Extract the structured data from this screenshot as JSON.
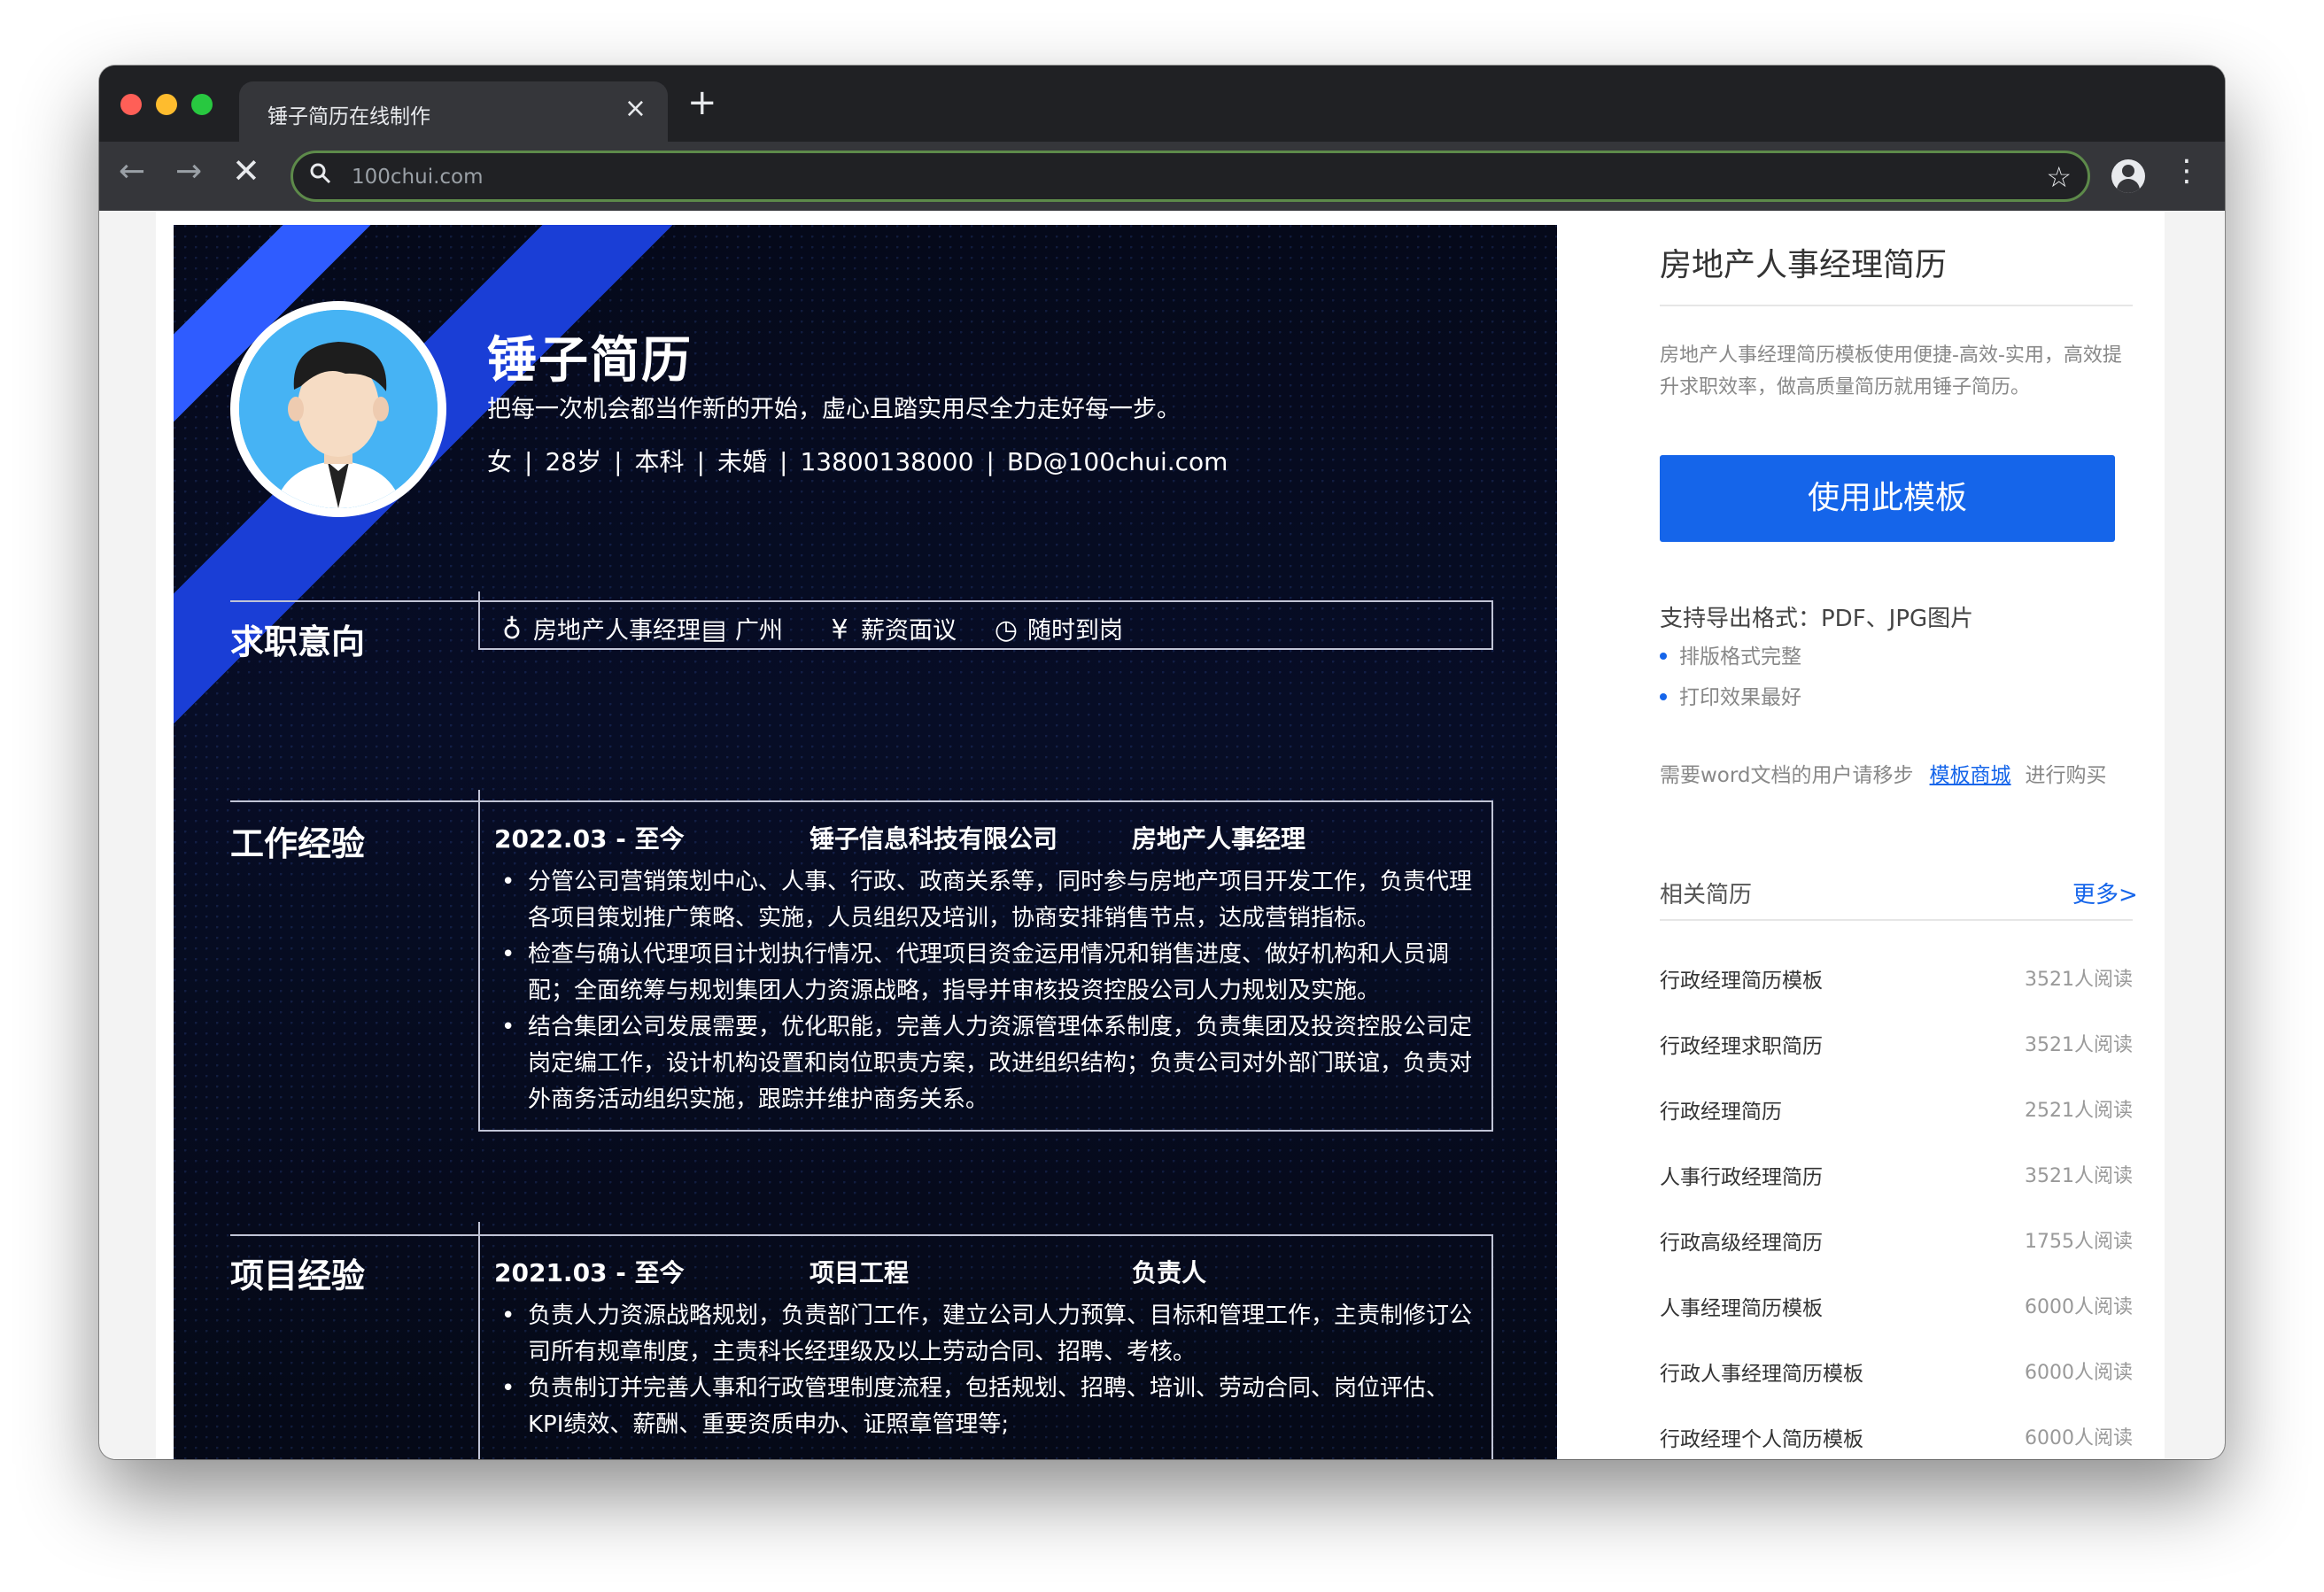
{
  "browser": {
    "tab_title": "锤子简历在线制作",
    "tab_close": "×",
    "new_tab": "+",
    "url": "100chui.com",
    "back": "←",
    "forward": "→",
    "stop": "✕",
    "star": "☆",
    "menu": "⋮",
    "search_icon": "⚲"
  },
  "resume": {
    "name": "锤子简历",
    "motto": "把每一次机会都当作新的开始，虚心且踏实用尽全力走好每一步。",
    "info": [
      "女",
      "28岁",
      "本科",
      "未婚",
      "13800138000",
      "BD@100chui.com"
    ],
    "info_sep": "|",
    "intent": {
      "title": "求职意向",
      "items": [
        {
          "icon": "tie-icon",
          "glyph": "♁",
          "label": "房地产人事经理"
        },
        {
          "icon": "building-icon",
          "glyph": "▤",
          "label": "广州"
        },
        {
          "icon": "yen-icon",
          "glyph": "¥",
          "label": "薪资面议"
        },
        {
          "icon": "clock-icon",
          "glyph": "◷",
          "label": "随时到岗"
        }
      ]
    },
    "work": {
      "title": "工作经验",
      "date": "2022.03 - 至今",
      "company": "锤子信息科技有限公司",
      "position": "房地产人事经理",
      "bullets": [
        "分管公司营销策划中心、人事、行政、政商关系等，同时参与房地产项目开发工作，负责代理各项目策划推广策略、实施，人员组织及培训，协商安排销售节点，达成营销指标。",
        "检查与确认代理项目计划执行情况、代理项目资金运用情况和销售进度、做好机构和人员调配；全面统筹与规划集团人力资源战略，指导并审核投资控股公司人力规划及实施。",
        "结合集团公司发展需要，优化职能，完善人力资源管理体系制度，负责集团及投资控股公司定岗定编工作，设计机构设置和岗位职责方案，改进组织结构；负责公司对外部门联谊，负责对外商务活动组织实施，跟踪并维护商务关系。"
      ]
    },
    "project": {
      "title": "项目经验",
      "date": "2021.03 - 至今",
      "name": "项目工程",
      "role": "负责人",
      "bullets": [
        "负责人力资源战略规划，负责部门工作，建立公司人力预算、目标和管理工作，主责制修订公司所有规章制度，主责科长经理级及以上劳动合同、招聘、考核。",
        "负责制订并完善人事和行政管理制度流程，包括规划、招聘、培训、劳动合同、岗位评估、KPI绩效、薪酬、重要资质申办、证照章管理等;"
      ]
    }
  },
  "sidebar": {
    "title": "房地产人事经理简历",
    "description": "房地产人事经理简历模板使用便捷-高效-实用，高效提升求职效率，做高质量简历就用锤子简历。",
    "use_button": "使用此模板",
    "formats": "支持导出格式：PDF、JPG图片",
    "bullets": [
      "排版格式完整",
      "打印效果最好"
    ],
    "word_note_prefix": "需要word文档的用户请移步",
    "word_link": "模板商城",
    "word_note_suffix": "进行购买",
    "related_title": "相关简历",
    "more": "更多>",
    "related": [
      {
        "name": "行政经理简历模板",
        "reads": "3521人阅读"
      },
      {
        "name": "行政经理求职简历",
        "reads": "3521人阅读"
      },
      {
        "name": "行政经理简历",
        "reads": "2521人阅读"
      },
      {
        "name": "人事行政经理简历",
        "reads": "3521人阅读"
      },
      {
        "name": "行政高级经理简历",
        "reads": "1755人阅读"
      },
      {
        "name": "人事经理简历模板",
        "reads": "6000人阅读"
      },
      {
        "name": "行政人事经理简历模板",
        "reads": "6000人阅读"
      },
      {
        "name": "行政经理个人简历模板",
        "reads": "6000人阅读"
      }
    ]
  },
  "colors": {
    "accent_blue": "#1565ea",
    "resume_bg": "#070d26",
    "stripe_blue": "#2f5cff"
  }
}
